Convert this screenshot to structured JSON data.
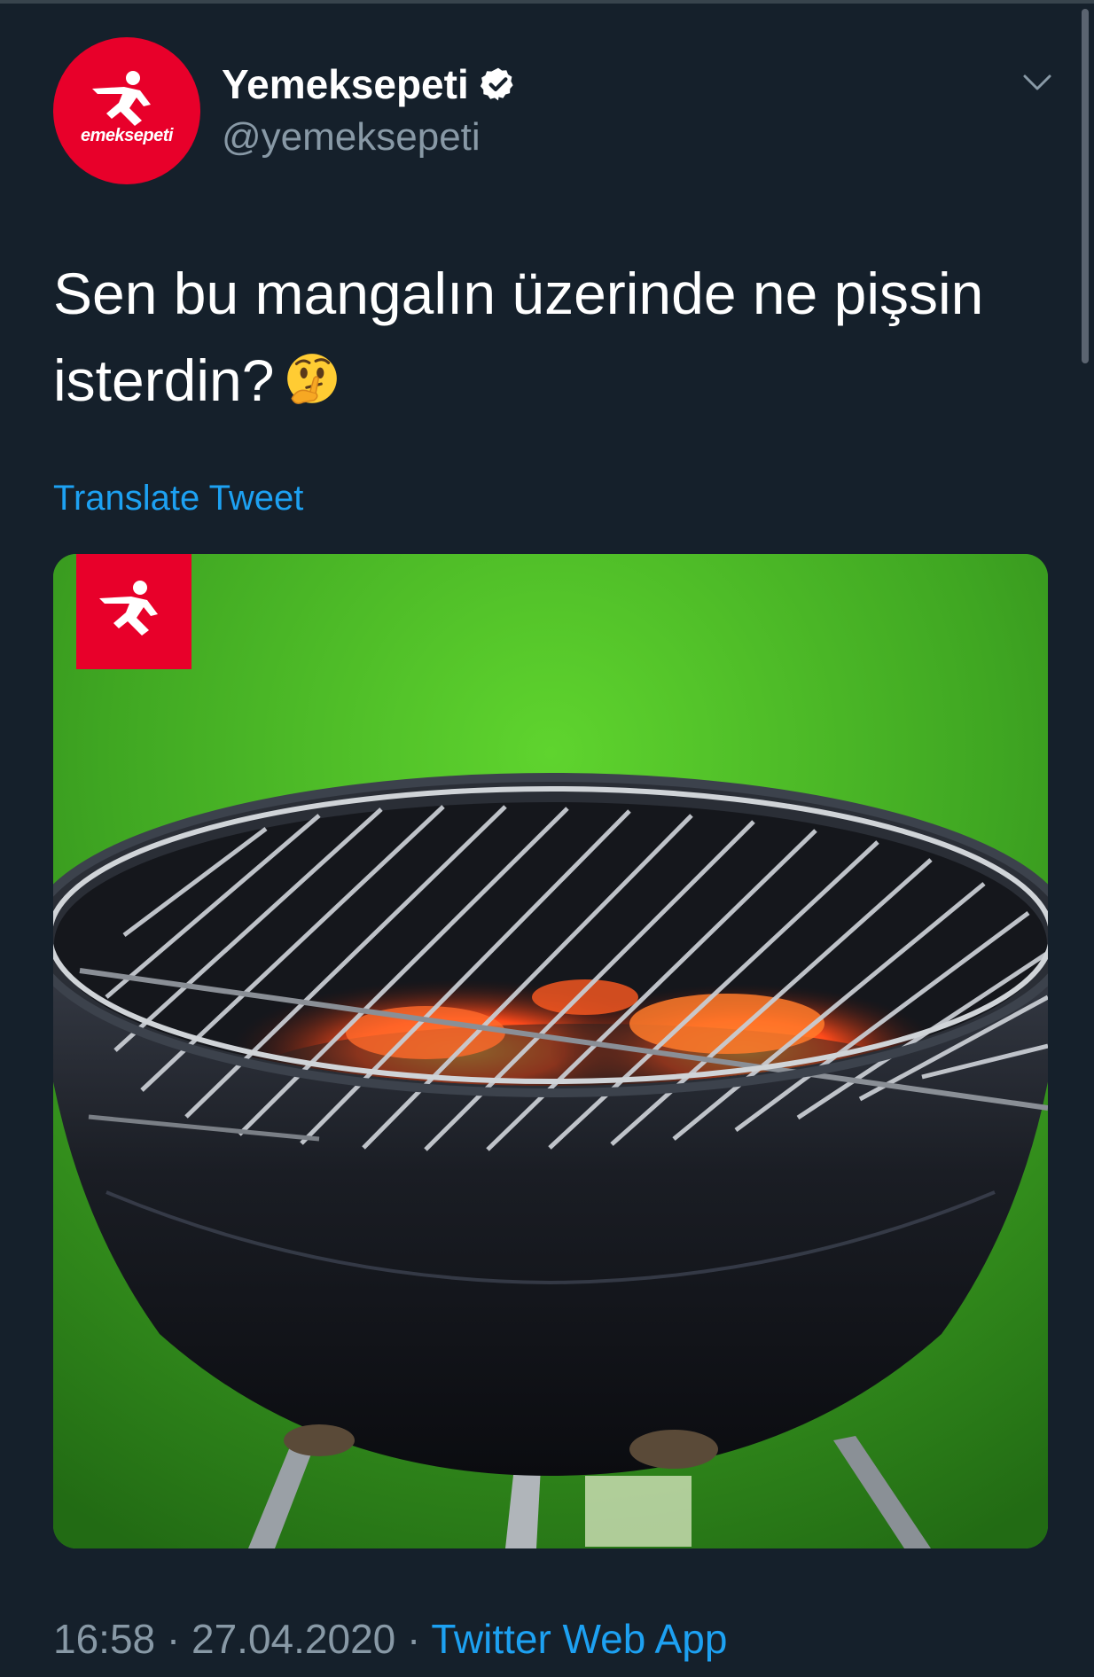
{
  "tweet": {
    "display_name": "Yemeksepeti",
    "handle": "@yemeksepeti",
    "verified_icon": "verified-badge-icon",
    "avatar_text": "emeksepeti",
    "text": "Sen bu mangalın üzerinde ne pişsin isterdin?",
    "emoji": "thinking-face-emoji",
    "translate_label": "Translate Tweet",
    "time": "16:58",
    "date": "27.04.2020",
    "separator": "·",
    "source": "Twitter Web App"
  },
  "colors": {
    "background": "#15202b",
    "accent": "#1da1f2",
    "secondary_text": "#8899a6",
    "brand_red": "#e8002a"
  }
}
